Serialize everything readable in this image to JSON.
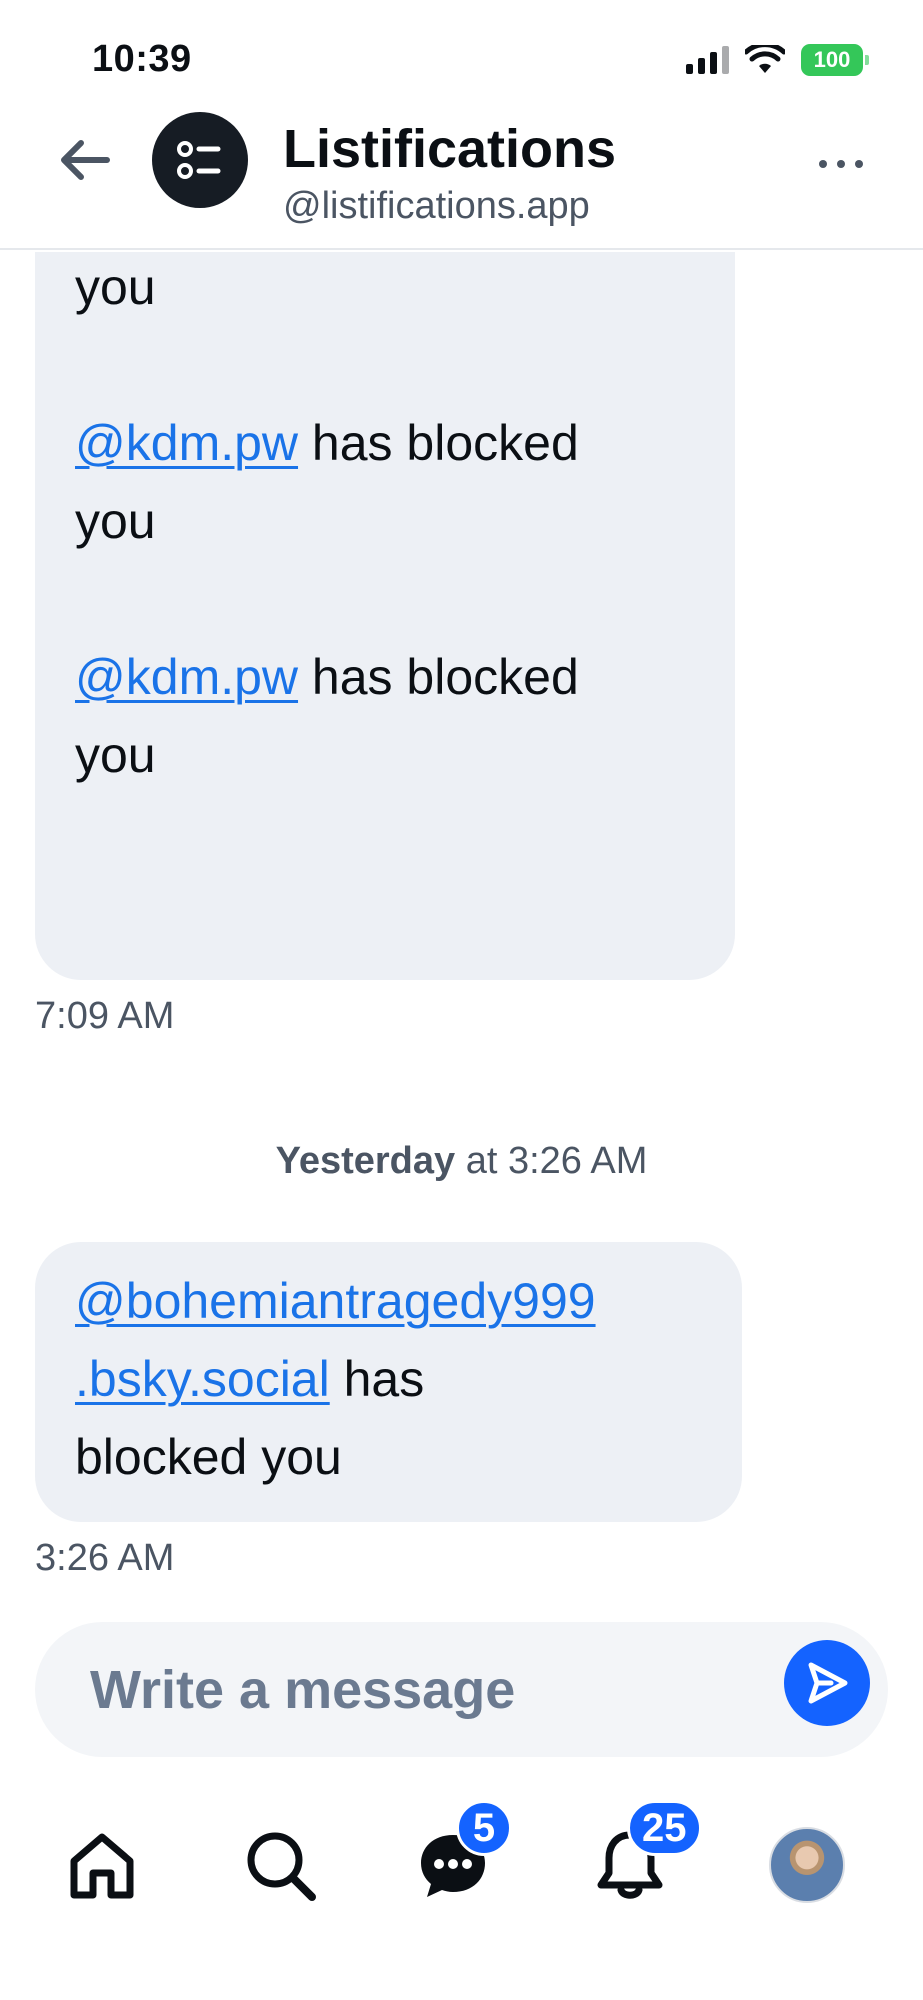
{
  "status_bar": {
    "time": "10:39",
    "battery": "100"
  },
  "header": {
    "title": "Listifications",
    "handle": "@listifications.app"
  },
  "messages": {
    "first_bubble": {
      "lines": [
        {
          "text": "you"
        },
        {
          "link": "@kdm.pw",
          "rest": " has blocked"
        },
        {
          "text": "you"
        },
        {
          "link": "@kdm.pw",
          "rest": " has blocked"
        },
        {
          "text": "you"
        }
      ],
      "time": "7:09 AM"
    },
    "day_separator": {
      "day": "Yesterday",
      "rest": " at 3:26 AM"
    },
    "second_bubble": {
      "link_line1": "@bohemiantragedy999",
      "link_line2": ".bsky.social",
      "rest_line2": " has",
      "line3": "blocked you",
      "time": "3:26 AM"
    }
  },
  "composer": {
    "placeholder": "Write a message"
  },
  "nav": {
    "messages_badge": "5",
    "notifications_badge": "25"
  },
  "colors": {
    "accent": "#1463ff",
    "link": "#1a73e8",
    "bubble": "#edf0f5",
    "battery": "#34c759"
  }
}
